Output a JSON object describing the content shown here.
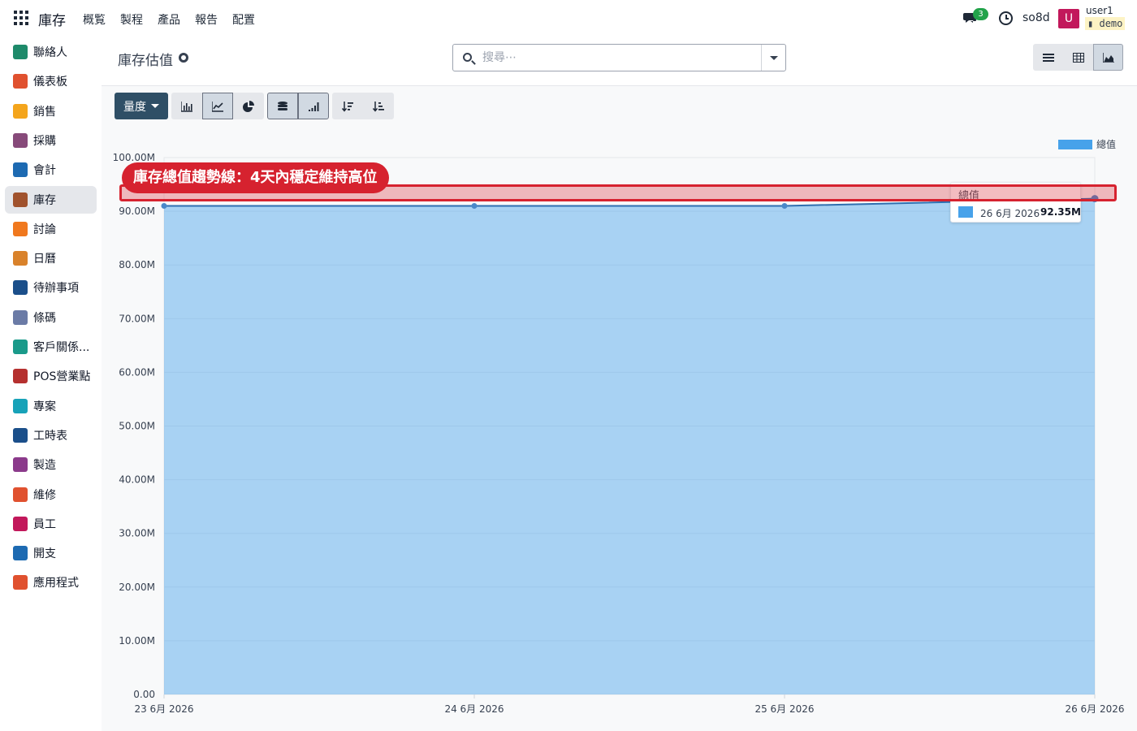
{
  "navbar": {
    "brand": "庫存",
    "menu": [
      "概覧",
      "製程",
      "產品",
      "報告",
      "配置"
    ],
    "chat_badge": "3",
    "company": "so8d",
    "avatar_letter": "U",
    "user_name": "user1",
    "database": "demo"
  },
  "sidebar": {
    "items": [
      {
        "label": "聯絡人",
        "color": "#1e8a6a"
      },
      {
        "label": "儀表板",
        "color": "#e0512f"
      },
      {
        "label": "銷售",
        "color": "#f4a51c"
      },
      {
        "label": "採購",
        "color": "#874a7a"
      },
      {
        "label": "會計",
        "color": "#1d6ab2"
      },
      {
        "label": "庫存",
        "color": "#a0522d"
      },
      {
        "label": "討論",
        "color": "#f0781e"
      },
      {
        "label": "日曆",
        "color": "#d9822b"
      },
      {
        "label": "待辦事項",
        "color": "#1b4f8a"
      },
      {
        "label": "條碼",
        "color": "#6b7ba6"
      },
      {
        "label": "客戶關係...",
        "color": "#1a9a8a"
      },
      {
        "label": "POS營業點",
        "color": "#b5302f"
      },
      {
        "label": "專案",
        "color": "#17a2b8"
      },
      {
        "label": "工時表",
        "color": "#1b4f8a"
      },
      {
        "label": "製造",
        "color": "#8b3a8b"
      },
      {
        "label": "維修",
        "color": "#e0512f"
      },
      {
        "label": "員工",
        "color": "#c2185b"
      },
      {
        "label": "開支",
        "color": "#1d6ab2"
      },
      {
        "label": "應用程式",
        "color": "#e0512f"
      }
    ],
    "active_index": 5
  },
  "control": {
    "title": "庫存估值",
    "search_placeholder": "搜尋⋯"
  },
  "toolbar": {
    "measure_label": "量度"
  },
  "chart_data": {
    "type": "area",
    "x": [
      "23 6月 2026",
      "24 6月 2026",
      "25 6月 2026",
      "26 6月 2026"
    ],
    "series": [
      {
        "name": "總值",
        "values": [
          91.0,
          91.0,
          91.0,
          92.35
        ],
        "color": "#47a2ea"
      }
    ],
    "y_ticks": [
      "0.00",
      "10.00M",
      "20.00M",
      "30.00M",
      "40.00M",
      "50.00M",
      "60.00M",
      "70.00M",
      "80.00M",
      "90.00M",
      "100.00M"
    ],
    "ylim": [
      0,
      100
    ],
    "y_unit": "M",
    "grid": true,
    "legend_position": "top-right"
  },
  "tooltip": {
    "title": "總值",
    "date": "26 6月 2026",
    "value": "92.35M"
  },
  "annotation": {
    "text": "庫存總值趨勢線：4天內穩定維持高位"
  }
}
